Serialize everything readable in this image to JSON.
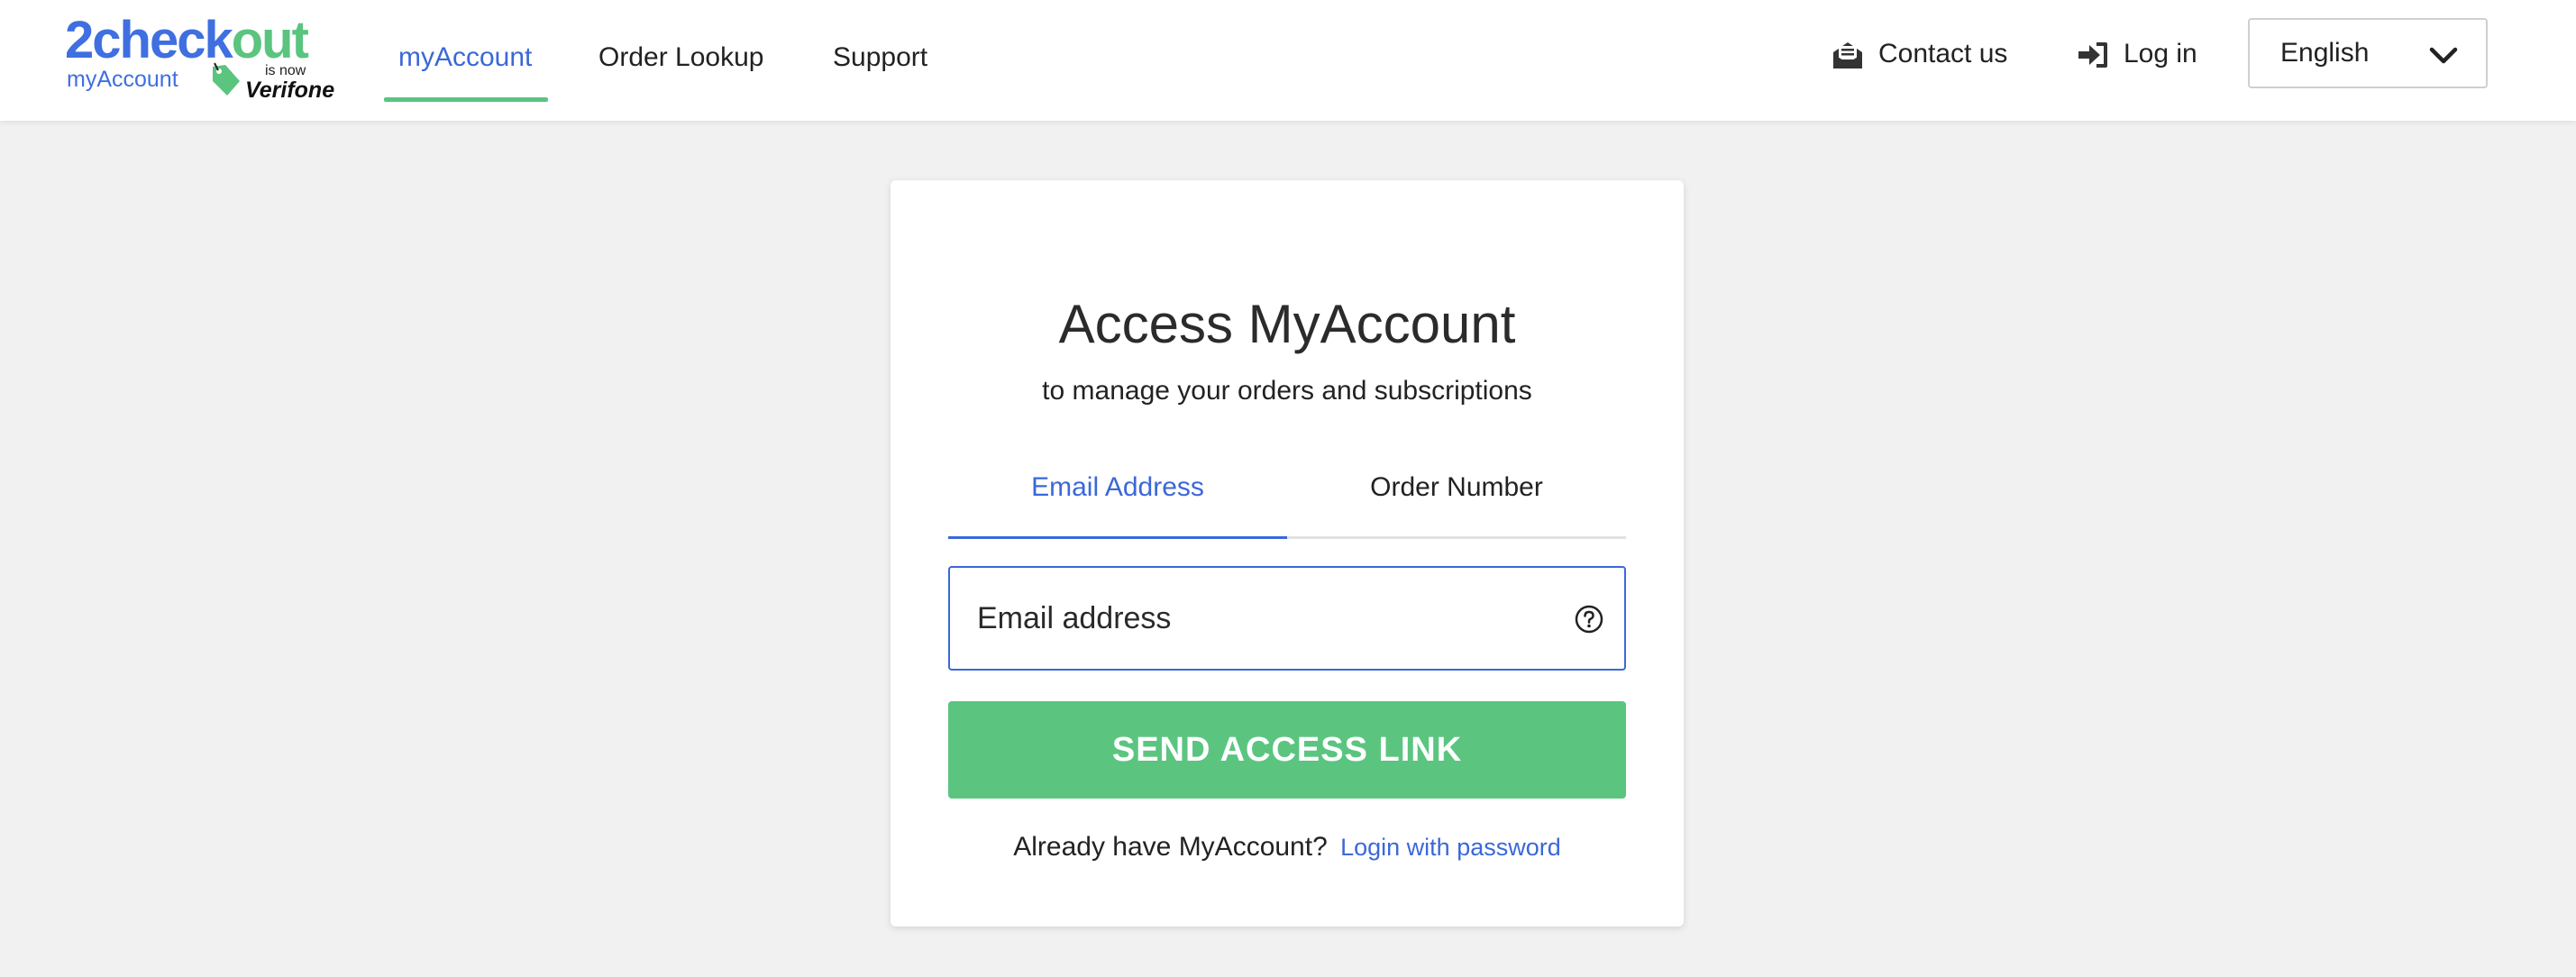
{
  "header": {
    "logo": {
      "brand_part1": "2chec",
      "brand_part2": "k",
      "brand_part3": "out",
      "sub": "myAccount",
      "is_now": "is now",
      "partner": "Verifone",
      "brand_blue": "#3f6fe0",
      "brand_green": "#5bc47f"
    },
    "nav": [
      {
        "label": "myAccount",
        "active": true
      },
      {
        "label": "Order Lookup",
        "active": false
      },
      {
        "label": "Support",
        "active": false
      }
    ],
    "contact_label": "Contact us",
    "contact_icon": "envelope-open-icon",
    "login_label": "Log in",
    "login_icon": "sign-in-icon",
    "language": {
      "selected": "English",
      "icon": "chevron-down-icon"
    }
  },
  "card": {
    "title": "Access MyAccount",
    "subtitle": "to manage your orders and subscriptions",
    "tabs": [
      {
        "label": "Email Address",
        "active": true
      },
      {
        "label": "Order Number",
        "active": false
      }
    ],
    "email_field": {
      "placeholder": "Email address",
      "value": "",
      "help_icon": "question-circle-icon"
    },
    "send_button": "SEND ACCESS LINK",
    "already_text": "Already have MyAccount?",
    "login_link": "Login with password"
  },
  "colors": {
    "accent_blue": "#3a68d8",
    "accent_green": "#5bc580",
    "background": "#f1f1f1"
  }
}
